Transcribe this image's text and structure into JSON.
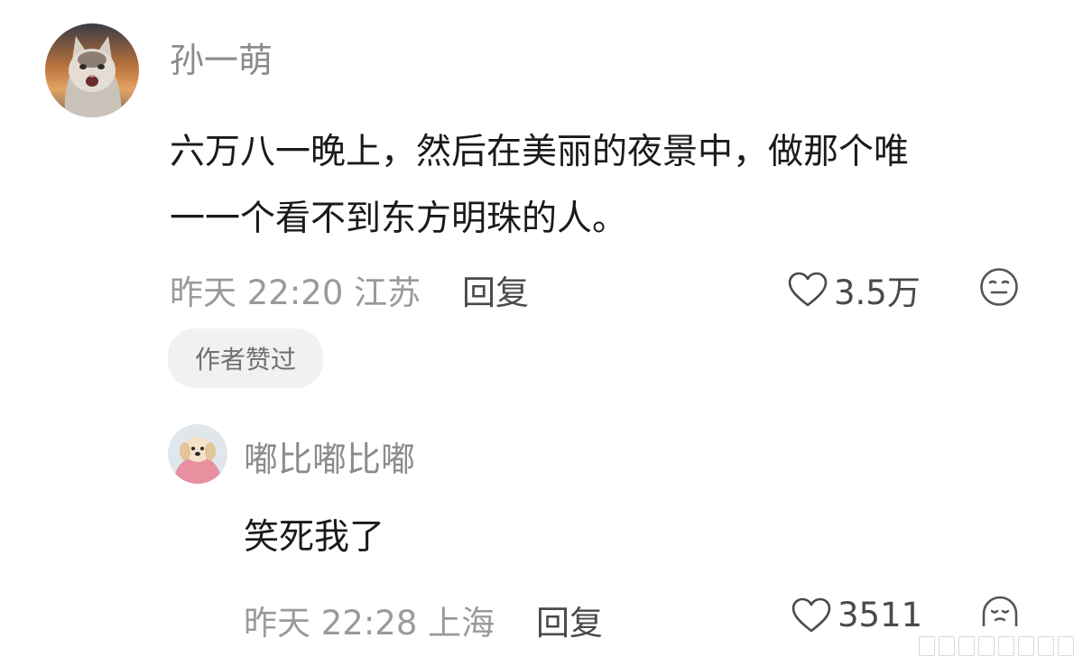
{
  "colors": {
    "username": "#8b8b8b",
    "content": "#1a1a1a",
    "meta": "#9a9a9a",
    "action": "#4a4a4a",
    "badge_bg": "#f1f1f1"
  },
  "comment": {
    "username": "孙一萌",
    "avatar_icon": "cat-avatar-icon",
    "text": "六万八一晚上，然后在美丽的夜景中，做那个唯\n一一个看不到东方明珠的人。",
    "time": "昨天 22:20",
    "location": "江苏",
    "reply_label": "回复",
    "like_icon": "heart-icon",
    "likes": "3.5万",
    "emoji_icon": "neutral-face-icon",
    "badge": "作者赞过"
  },
  "reply": {
    "username": "嘟比嘟比嘟",
    "avatar_icon": "puppy-avatar-icon",
    "text": "笑死我了",
    "time": "昨天 22:28",
    "location": "上海",
    "reply_label": "回复",
    "like_icon": "heart-icon",
    "likes": "3511",
    "emoji_icon": "crying-face-icon"
  }
}
